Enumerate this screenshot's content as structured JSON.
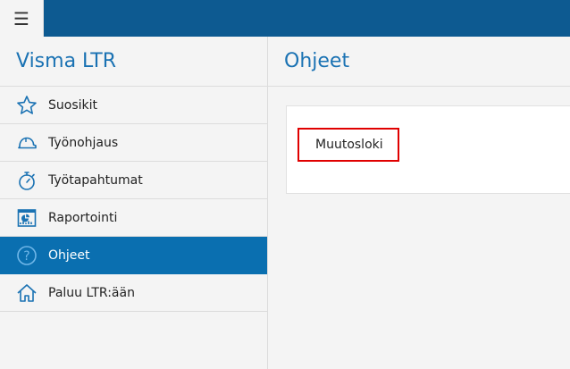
{
  "header": {
    "menu_icon": "hamburger-icon",
    "accent_color": "#0d5a91"
  },
  "sidebar": {
    "app_title": "Visma LTR",
    "items": [
      {
        "label": "Suosikit",
        "icon": "star-icon"
      },
      {
        "label": "Työnohjaus",
        "icon": "helmet-icon"
      },
      {
        "label": "Työtapahtumat",
        "icon": "stopwatch-icon"
      },
      {
        "label": "Raportointi",
        "icon": "report-icon"
      },
      {
        "label": "Ohjeet",
        "icon": "help-icon",
        "active": true
      },
      {
        "label": "Paluu LTR:ään",
        "icon": "home-icon"
      }
    ],
    "active_color": "#0a6fb0"
  },
  "main": {
    "title": "Ohjeet",
    "links": [
      {
        "label": "Muutosloki"
      }
    ]
  }
}
